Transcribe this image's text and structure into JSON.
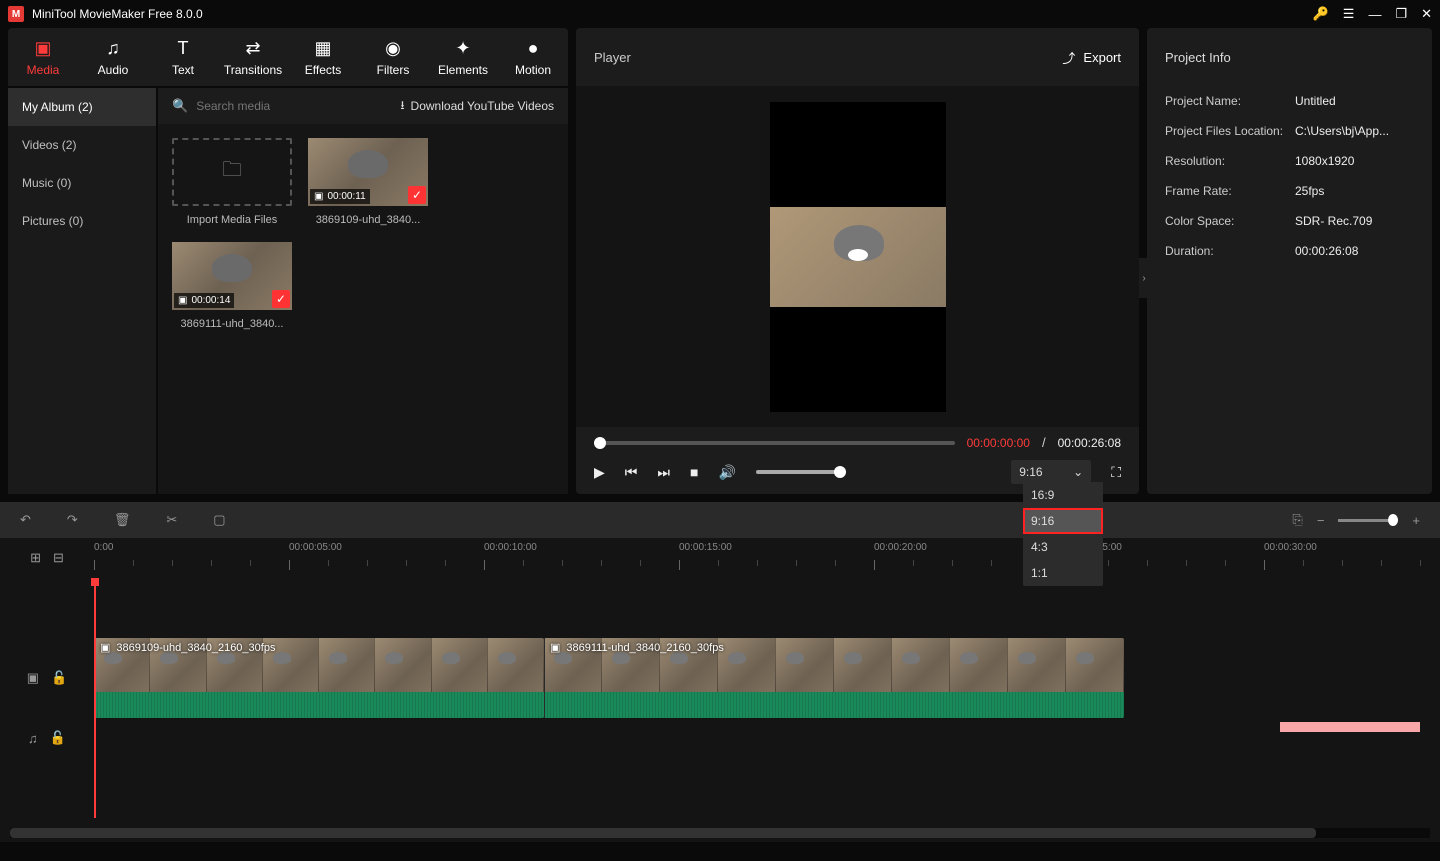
{
  "app": {
    "title": "MiniTool MovieMaker Free 8.0.0"
  },
  "tabs": {
    "media": "Media",
    "audio": "Audio",
    "text": "Text",
    "transitions": "Transitions",
    "effects": "Effects",
    "filters": "Filters",
    "elements": "Elements",
    "motion": "Motion"
  },
  "categories": {
    "myalbum": "My Album (2)",
    "videos": "Videos (2)",
    "music": "Music (0)",
    "pictures": "Pictures (0)"
  },
  "search": {
    "placeholder": "Search media",
    "download": "Download YouTube Videos"
  },
  "thumbs": {
    "import": "Import Media Files",
    "clip1_dur": "00:00:11",
    "clip1_name": "3869109-uhd_3840...",
    "clip2_dur": "00:00:14",
    "clip2_name": "3869111-uhd_3840..."
  },
  "player": {
    "label": "Player",
    "export": "Export",
    "current": "00:00:00:00",
    "sep": " / ",
    "duration": "00:00:26:08",
    "aspect_selected": "9:16",
    "aspect_options": {
      "o1": "16:9",
      "o2": "9:16",
      "o3": "4:3",
      "o4": "1:1"
    }
  },
  "info": {
    "title": "Project Info",
    "name_k": "Project Name:",
    "name_v": "Untitled",
    "loc_k": "Project Files Location:",
    "loc_v": "C:\\Users\\bj\\App...",
    "res_k": "Resolution:",
    "res_v": "1080x1920",
    "fps_k": "Frame Rate:",
    "fps_v": "25fps",
    "cs_k": "Color Space:",
    "cs_v": "SDR- Rec.709",
    "dur_k": "Duration:",
    "dur_v": "00:00:26:08"
  },
  "ruler": {
    "t0": "0:00",
    "t1": "00:00:05:00",
    "t2": "00:00:10:00",
    "t3": "00:00:15:00",
    "t4": "00:00:20:00",
    "t5": "00:00:25:00",
    "t6": "00:00:30:00"
  },
  "timeline": {
    "clip1": "3869109-uhd_3840_2160_30fps",
    "clip2": "3869111-uhd_3840_2160_30fps"
  }
}
